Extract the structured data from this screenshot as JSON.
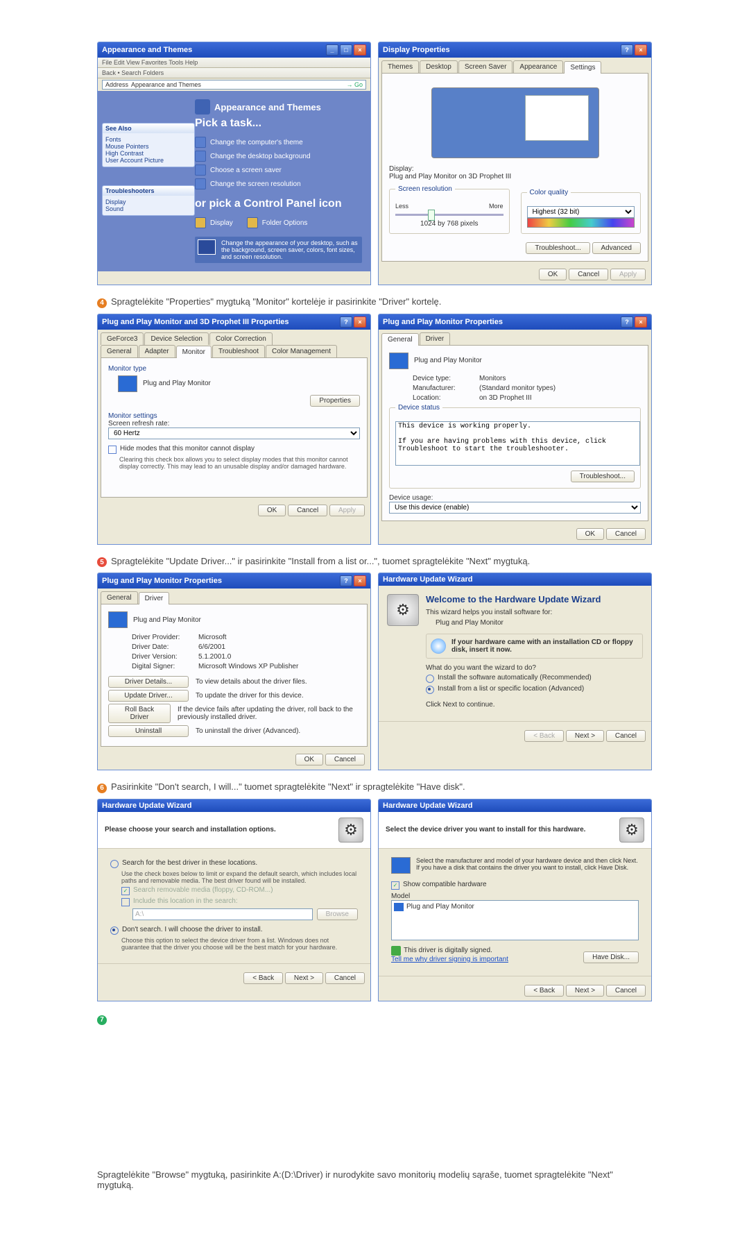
{
  "step4": {
    "text": "Spragtelėkite \"Properties\" mygtuką \"Monitor\" kortelėje ir pasirinkite \"Driver\" kortelę."
  },
  "step5": {
    "text": "Spragtelėkite \"Update Driver...\" ir pasirinkite \"Install from a list or...\", tuomet spragtelėkite \"Next\" mygtuką."
  },
  "step6": {
    "text": "Pasirinkite \"Don't search, I will...\" tuomet spragtelėkite \"Next\" ir spragtelėkite \"Have disk\"."
  },
  "step7": {
    "text": "Spragtelėkite \"Browse\" mygtuką, pasirinkite A:(D:\\Driver) ir nurodykite savo monitorių modelių sąraše, tuomet spragtelėkite \"Next\" mygtuką."
  },
  "explorer": {
    "title": "Appearance and Themes",
    "menu": "File   Edit   View   Favorites   Tools   Help",
    "toolbar": "Back  •  Search   Folders",
    "addr": "Appearance and Themes",
    "side1_hd": "See Also",
    "side1_items": [
      "Fonts",
      "Mouse Pointers",
      "High Contrast",
      "User Account Picture"
    ],
    "side2_hd": "Troubleshooters",
    "side2_items": [
      "Display",
      "Sound"
    ],
    "heading": "Appearance and Themes",
    "pick": "Pick a task...",
    "tasks": [
      "Change the computer's theme",
      "Change the desktop background",
      "Choose a screen saver",
      "Change the screen resolution"
    ],
    "orpick": "or pick a Control Panel icon",
    "icons": [
      "Display",
      "Folder Options"
    ],
    "tip": "Change the appearance of your desktop, such as the background, screen saver, colors, font sizes, and screen resolution."
  },
  "dispProps": {
    "title": "Display Properties",
    "tabs": [
      "Themes",
      "Desktop",
      "Screen Saver",
      "Appearance",
      "Settings"
    ],
    "displayLbl": "Display:",
    "displayVal": "Plug and Play Monitor on 3D Prophet III",
    "resLbl": "Screen resolution",
    "less": "Less",
    "more": "More",
    "resVal": "1024 by 768 pixels",
    "cqLbl": "Color quality",
    "cqVal": "Highest (32 bit)",
    "tshoot": "Troubleshoot...",
    "adv": "Advanced",
    "ok": "OK",
    "cancel": "Cancel",
    "apply": "Apply"
  },
  "pnp3d": {
    "title": "Plug and Play Monitor and 3D Prophet III Properties",
    "tabsTop": [
      "GeForce3",
      "Device Selection",
      "Color Correction"
    ],
    "tabsBot": [
      "General",
      "Adapter",
      "Monitor",
      "Troubleshoot",
      "Color Management"
    ],
    "mtype": "Monitor type",
    "mname": "Plug and Play Monitor",
    "propBtn": "Properties",
    "mset": "Monitor settings",
    "refr": "Screen refresh rate:",
    "refrVal": "60 Hertz",
    "hide": "Hide modes that this monitor cannot display",
    "hideHelp": "Clearing this check box allows you to select display modes that this monitor cannot display correctly. This may lead to an unusable display and/or damaged hardware.",
    "ok": "OK",
    "cancel": "Cancel",
    "apply": "Apply"
  },
  "pnpGen": {
    "title": "Plug and Play Monitor Properties",
    "tabs": [
      "General",
      "Driver"
    ],
    "name": "Plug and Play Monitor",
    "dtypeK": "Device type:",
    "dtypeV": "Monitors",
    "manK": "Manufacturer:",
    "manV": "(Standard monitor types)",
    "locK": "Location:",
    "locV": "on 3D Prophet III",
    "dstat": "Device status",
    "working": "This device is working properly.",
    "help": "If you are having problems with this device, click Troubleshoot to start the troubleshooter.",
    "tshoot": "Troubleshoot...",
    "usage": "Device usage:",
    "usageVal": "Use this device (enable)",
    "ok": "OK",
    "cancel": "Cancel"
  },
  "pnpDrv": {
    "title": "Plug and Play Monitor Properties",
    "tabs": [
      "General",
      "Driver"
    ],
    "name": "Plug and Play Monitor",
    "provK": "Driver Provider:",
    "provV": "Microsoft",
    "dateK": "Driver Date:",
    "dateV": "6/6/2001",
    "verK": "Driver Version:",
    "verV": "5.1.2001.0",
    "sigK": "Digital Signer:",
    "sigV": "Microsoft Windows XP Publisher",
    "det": "Driver Details...",
    "detT": "To view details about the driver files.",
    "upd": "Update Driver...",
    "updT": "To update the driver for this device.",
    "roll": "Roll Back Driver",
    "rollT": "If the device fails after updating the driver, roll back to the previously installed driver.",
    "unin": "Uninstall",
    "uninT": "To uninstall the driver (Advanced).",
    "ok": "OK",
    "cancel": "Cancel"
  },
  "wiz1": {
    "title": "Hardware Update Wizard",
    "welcome": "Welcome to the Hardware Update Wizard",
    "helps": "This wizard helps you install software for:",
    "dev": "Plug and Play Monitor",
    "cd": "If your hardware came with an installation CD or floppy disk, insert it now.",
    "what": "What do you want the wizard to do?",
    "opt1": "Install the software automatically (Recommended)",
    "opt2": "Install from a list or specific location (Advanced)",
    "cont": "Click Next to continue.",
    "back": "< Back",
    "next": "Next >",
    "cancel": "Cancel"
  },
  "wiz2": {
    "title": "Hardware Update Wizard",
    "head": "Please choose your search and installation options.",
    "opt1": "Search for the best driver in these locations.",
    "opt1h": "Use the check boxes below to limit or expand the default search, which includes local paths and removable media. The best driver found will be installed.",
    "chk1": "Search removable media (floppy, CD-ROM...)",
    "chk2": "Include this location in the search:",
    "path": "A:\\",
    "browse": "Browse",
    "opt2": "Don't search. I will choose the driver to install.",
    "opt2h": "Choose this option to select the device driver from a list. Windows does not guarantee that the driver you choose will be the best match for your hardware.",
    "back": "< Back",
    "next": "Next >",
    "cancel": "Cancel"
  },
  "wiz3": {
    "title": "Hardware Update Wizard",
    "head": "Select the device driver you want to install for this hardware.",
    "hint": "Select the manufacturer and model of your hardware device and then click Next. If you have a disk that contains the driver you want to install, click Have Disk.",
    "compat": "Show compatible hardware",
    "model": "Model",
    "item": "Plug and Play Monitor",
    "signed": "This driver is digitally signed.",
    "why": "Tell me why driver signing is important",
    "have": "Have Disk...",
    "back": "< Back",
    "next": "Next >",
    "cancel": "Cancel"
  }
}
